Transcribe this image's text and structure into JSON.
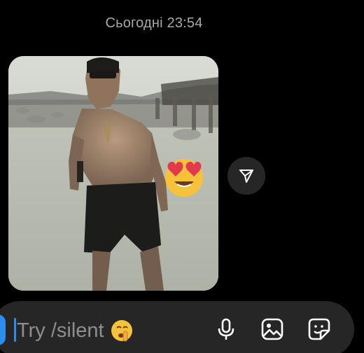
{
  "thread": {
    "timestamp": "Сьогодні 23:54"
  },
  "message": {
    "reaction": "smiling-face-with-heart-eyes"
  },
  "composer": {
    "placeholder": "Try /silent",
    "placeholder_emoji": "shushing-face"
  },
  "icons": {
    "share": "paper-plane-icon",
    "mic": "microphone-icon",
    "gallery": "image-icon",
    "sticker": "sticker-icon"
  },
  "colors": {
    "background": "#000000",
    "composer_background": "#262626",
    "accent_blue": "#2b8df0",
    "timestamp": "#a8a8a8",
    "placeholder": "#8e8e8e"
  }
}
